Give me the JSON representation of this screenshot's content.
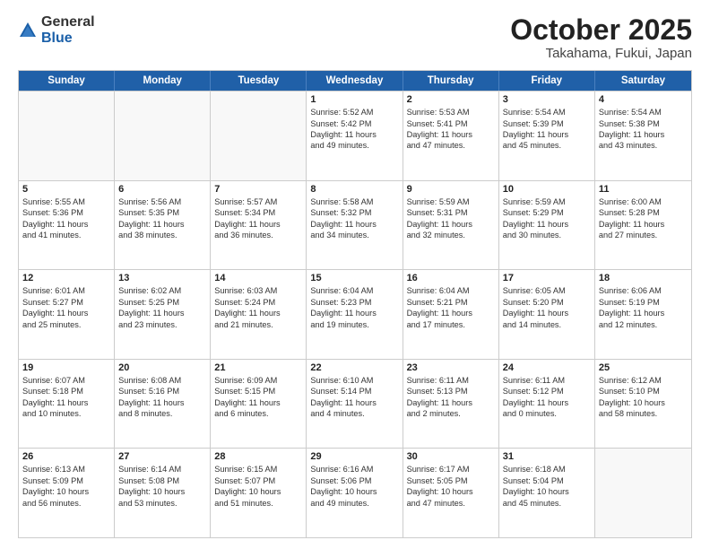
{
  "header": {
    "logo_general": "General",
    "logo_blue": "Blue",
    "month": "October 2025",
    "location": "Takahama, Fukui, Japan"
  },
  "weekdays": [
    "Sunday",
    "Monday",
    "Tuesday",
    "Wednesday",
    "Thursday",
    "Friday",
    "Saturday"
  ],
  "rows": [
    [
      {
        "day": "",
        "lines": [],
        "empty": true
      },
      {
        "day": "",
        "lines": [],
        "empty": true
      },
      {
        "day": "",
        "lines": [],
        "empty": true
      },
      {
        "day": "1",
        "lines": [
          "Sunrise: 5:52 AM",
          "Sunset: 5:42 PM",
          "Daylight: 11 hours",
          "and 49 minutes."
        ]
      },
      {
        "day": "2",
        "lines": [
          "Sunrise: 5:53 AM",
          "Sunset: 5:41 PM",
          "Daylight: 11 hours",
          "and 47 minutes."
        ]
      },
      {
        "day": "3",
        "lines": [
          "Sunrise: 5:54 AM",
          "Sunset: 5:39 PM",
          "Daylight: 11 hours",
          "and 45 minutes."
        ]
      },
      {
        "day": "4",
        "lines": [
          "Sunrise: 5:54 AM",
          "Sunset: 5:38 PM",
          "Daylight: 11 hours",
          "and 43 minutes."
        ]
      }
    ],
    [
      {
        "day": "5",
        "lines": [
          "Sunrise: 5:55 AM",
          "Sunset: 5:36 PM",
          "Daylight: 11 hours",
          "and 41 minutes."
        ]
      },
      {
        "day": "6",
        "lines": [
          "Sunrise: 5:56 AM",
          "Sunset: 5:35 PM",
          "Daylight: 11 hours",
          "and 38 minutes."
        ]
      },
      {
        "day": "7",
        "lines": [
          "Sunrise: 5:57 AM",
          "Sunset: 5:34 PM",
          "Daylight: 11 hours",
          "and 36 minutes."
        ]
      },
      {
        "day": "8",
        "lines": [
          "Sunrise: 5:58 AM",
          "Sunset: 5:32 PM",
          "Daylight: 11 hours",
          "and 34 minutes."
        ]
      },
      {
        "day": "9",
        "lines": [
          "Sunrise: 5:59 AM",
          "Sunset: 5:31 PM",
          "Daylight: 11 hours",
          "and 32 minutes."
        ]
      },
      {
        "day": "10",
        "lines": [
          "Sunrise: 5:59 AM",
          "Sunset: 5:29 PM",
          "Daylight: 11 hours",
          "and 30 minutes."
        ]
      },
      {
        "day": "11",
        "lines": [
          "Sunrise: 6:00 AM",
          "Sunset: 5:28 PM",
          "Daylight: 11 hours",
          "and 27 minutes."
        ]
      }
    ],
    [
      {
        "day": "12",
        "lines": [
          "Sunrise: 6:01 AM",
          "Sunset: 5:27 PM",
          "Daylight: 11 hours",
          "and 25 minutes."
        ]
      },
      {
        "day": "13",
        "lines": [
          "Sunrise: 6:02 AM",
          "Sunset: 5:25 PM",
          "Daylight: 11 hours",
          "and 23 minutes."
        ]
      },
      {
        "day": "14",
        "lines": [
          "Sunrise: 6:03 AM",
          "Sunset: 5:24 PM",
          "Daylight: 11 hours",
          "and 21 minutes."
        ]
      },
      {
        "day": "15",
        "lines": [
          "Sunrise: 6:04 AM",
          "Sunset: 5:23 PM",
          "Daylight: 11 hours",
          "and 19 minutes."
        ]
      },
      {
        "day": "16",
        "lines": [
          "Sunrise: 6:04 AM",
          "Sunset: 5:21 PM",
          "Daylight: 11 hours",
          "and 17 minutes."
        ]
      },
      {
        "day": "17",
        "lines": [
          "Sunrise: 6:05 AM",
          "Sunset: 5:20 PM",
          "Daylight: 11 hours",
          "and 14 minutes."
        ]
      },
      {
        "day": "18",
        "lines": [
          "Sunrise: 6:06 AM",
          "Sunset: 5:19 PM",
          "Daylight: 11 hours",
          "and 12 minutes."
        ]
      }
    ],
    [
      {
        "day": "19",
        "lines": [
          "Sunrise: 6:07 AM",
          "Sunset: 5:18 PM",
          "Daylight: 11 hours",
          "and 10 minutes."
        ]
      },
      {
        "day": "20",
        "lines": [
          "Sunrise: 6:08 AM",
          "Sunset: 5:16 PM",
          "Daylight: 11 hours",
          "and 8 minutes."
        ]
      },
      {
        "day": "21",
        "lines": [
          "Sunrise: 6:09 AM",
          "Sunset: 5:15 PM",
          "Daylight: 11 hours",
          "and 6 minutes."
        ]
      },
      {
        "day": "22",
        "lines": [
          "Sunrise: 6:10 AM",
          "Sunset: 5:14 PM",
          "Daylight: 11 hours",
          "and 4 minutes."
        ]
      },
      {
        "day": "23",
        "lines": [
          "Sunrise: 6:11 AM",
          "Sunset: 5:13 PM",
          "Daylight: 11 hours",
          "and 2 minutes."
        ]
      },
      {
        "day": "24",
        "lines": [
          "Sunrise: 6:11 AM",
          "Sunset: 5:12 PM",
          "Daylight: 11 hours",
          "and 0 minutes."
        ]
      },
      {
        "day": "25",
        "lines": [
          "Sunrise: 6:12 AM",
          "Sunset: 5:10 PM",
          "Daylight: 10 hours",
          "and 58 minutes."
        ]
      }
    ],
    [
      {
        "day": "26",
        "lines": [
          "Sunrise: 6:13 AM",
          "Sunset: 5:09 PM",
          "Daylight: 10 hours",
          "and 56 minutes."
        ]
      },
      {
        "day": "27",
        "lines": [
          "Sunrise: 6:14 AM",
          "Sunset: 5:08 PM",
          "Daylight: 10 hours",
          "and 53 minutes."
        ]
      },
      {
        "day": "28",
        "lines": [
          "Sunrise: 6:15 AM",
          "Sunset: 5:07 PM",
          "Daylight: 10 hours",
          "and 51 minutes."
        ]
      },
      {
        "day": "29",
        "lines": [
          "Sunrise: 6:16 AM",
          "Sunset: 5:06 PM",
          "Daylight: 10 hours",
          "and 49 minutes."
        ]
      },
      {
        "day": "30",
        "lines": [
          "Sunrise: 6:17 AM",
          "Sunset: 5:05 PM",
          "Daylight: 10 hours",
          "and 47 minutes."
        ]
      },
      {
        "day": "31",
        "lines": [
          "Sunrise: 6:18 AM",
          "Sunset: 5:04 PM",
          "Daylight: 10 hours",
          "and 45 minutes."
        ]
      },
      {
        "day": "",
        "lines": [],
        "empty": true
      }
    ]
  ]
}
